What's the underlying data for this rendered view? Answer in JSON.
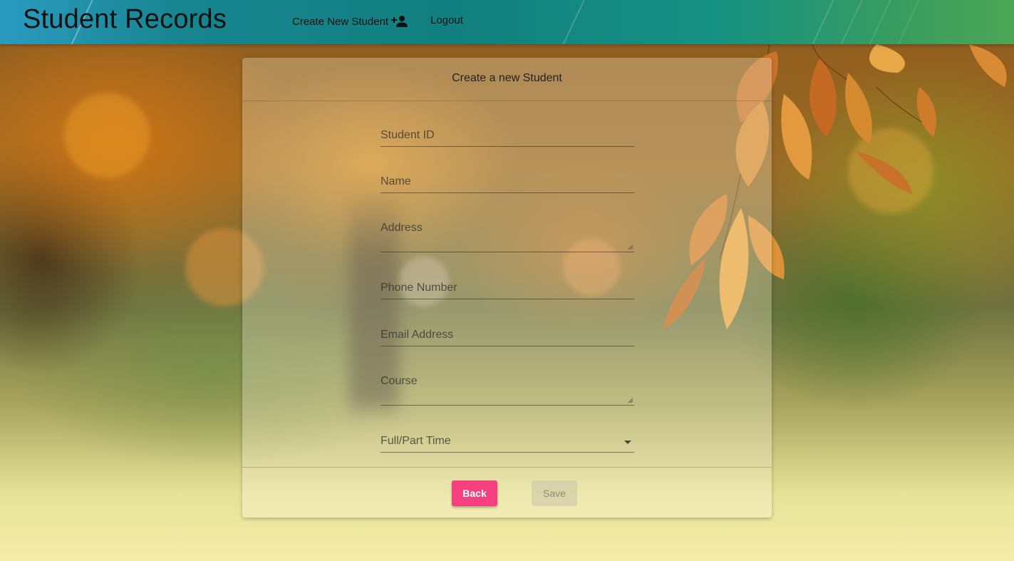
{
  "header": {
    "app_title": "Student Records",
    "nav": {
      "create_label": "Create New Student",
      "create_icon": "person-add-icon",
      "logout_label": "Logout"
    }
  },
  "form": {
    "title": "Create a new Student",
    "fields": {
      "student_id": {
        "label": "Student ID",
        "value": ""
      },
      "name": {
        "label": "Name",
        "value": ""
      },
      "address": {
        "label": "Address",
        "value": ""
      },
      "phone": {
        "label": "Phone Number",
        "value": ""
      },
      "email": {
        "label": "Email Address",
        "value": ""
      },
      "course": {
        "label": "Course",
        "value": ""
      },
      "enrollment": {
        "label": "Full/Part Time",
        "value": ""
      }
    },
    "actions": {
      "back_label": "Back",
      "save_label": "Save",
      "save_disabled": true
    }
  },
  "colors": {
    "accent_button": "#f6407f",
    "header_gradient_start": "#2a9bc0",
    "header_gradient_end": "#4ca656"
  }
}
